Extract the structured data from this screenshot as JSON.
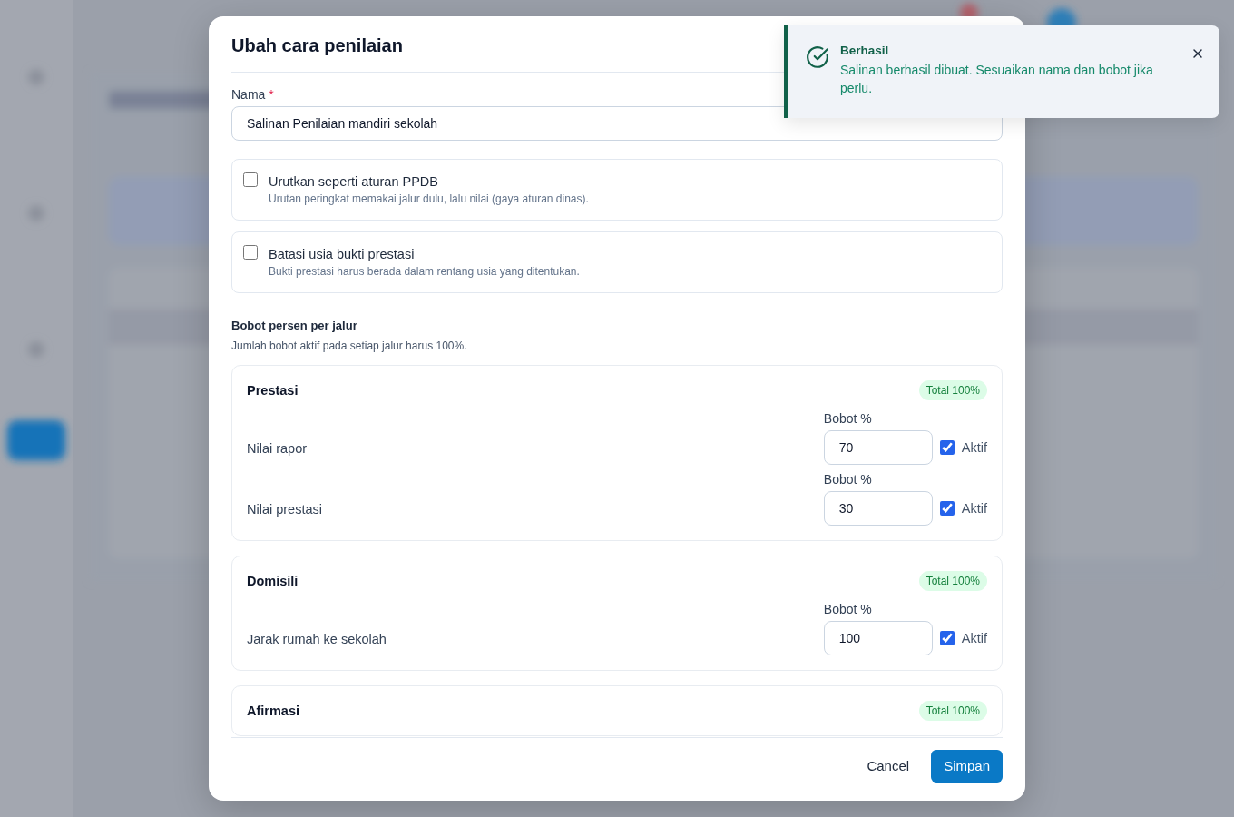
{
  "dialog": {
    "title": "Ubah cara penilaian",
    "name_field": {
      "label": "Nama",
      "required_mark": "*",
      "value": "Salinan Penilaian mandiri sekolah"
    },
    "options": [
      {
        "label": "Urutkan seperti aturan PPDB",
        "description": "Urutan peringkat memakai jalur dulu, lalu nilai (gaya aturan dinas).",
        "checked": false
      },
      {
        "label": "Batasi usia bukti prestasi",
        "description": "Bukti prestasi harus berada dalam rentang usia yang ditentukan.",
        "checked": false
      }
    ],
    "weights": {
      "title": "Bobot persen per jalur",
      "hint": "Jumlah bobot aktif pada setiap jalur harus 100%.",
      "groups": [
        {
          "name": "Prestasi",
          "total": "Total 100%",
          "items": [
            {
              "label": "Nilai rapor",
              "field_label": "Bobot %",
              "value": "70",
              "active_label": "Aktif",
              "active": true
            },
            {
              "label": "Nilai prestasi",
              "field_label": "Bobot %",
              "value": "30",
              "active_label": "Aktif",
              "active": true
            }
          ]
        },
        {
          "name": "Domisili",
          "total": "Total 100%",
          "items": [
            {
              "label": "Jarak rumah ke sekolah",
              "field_label": "Bobot %",
              "value": "100",
              "active_label": "Aktif",
              "active": true
            }
          ]
        },
        {
          "name": "Afirmasi",
          "total": "Total 100%"
        }
      ]
    },
    "buttons": [
      {
        "kind": "secondary",
        "label": "Cancel"
      },
      {
        "kind": "primary",
        "label": "Simpan"
      }
    ]
  },
  "toast": {
    "title": "Berhasil",
    "message": "Salinan berhasil dibuat. Sesuaikan nama dan bobot jika perlu."
  }
}
